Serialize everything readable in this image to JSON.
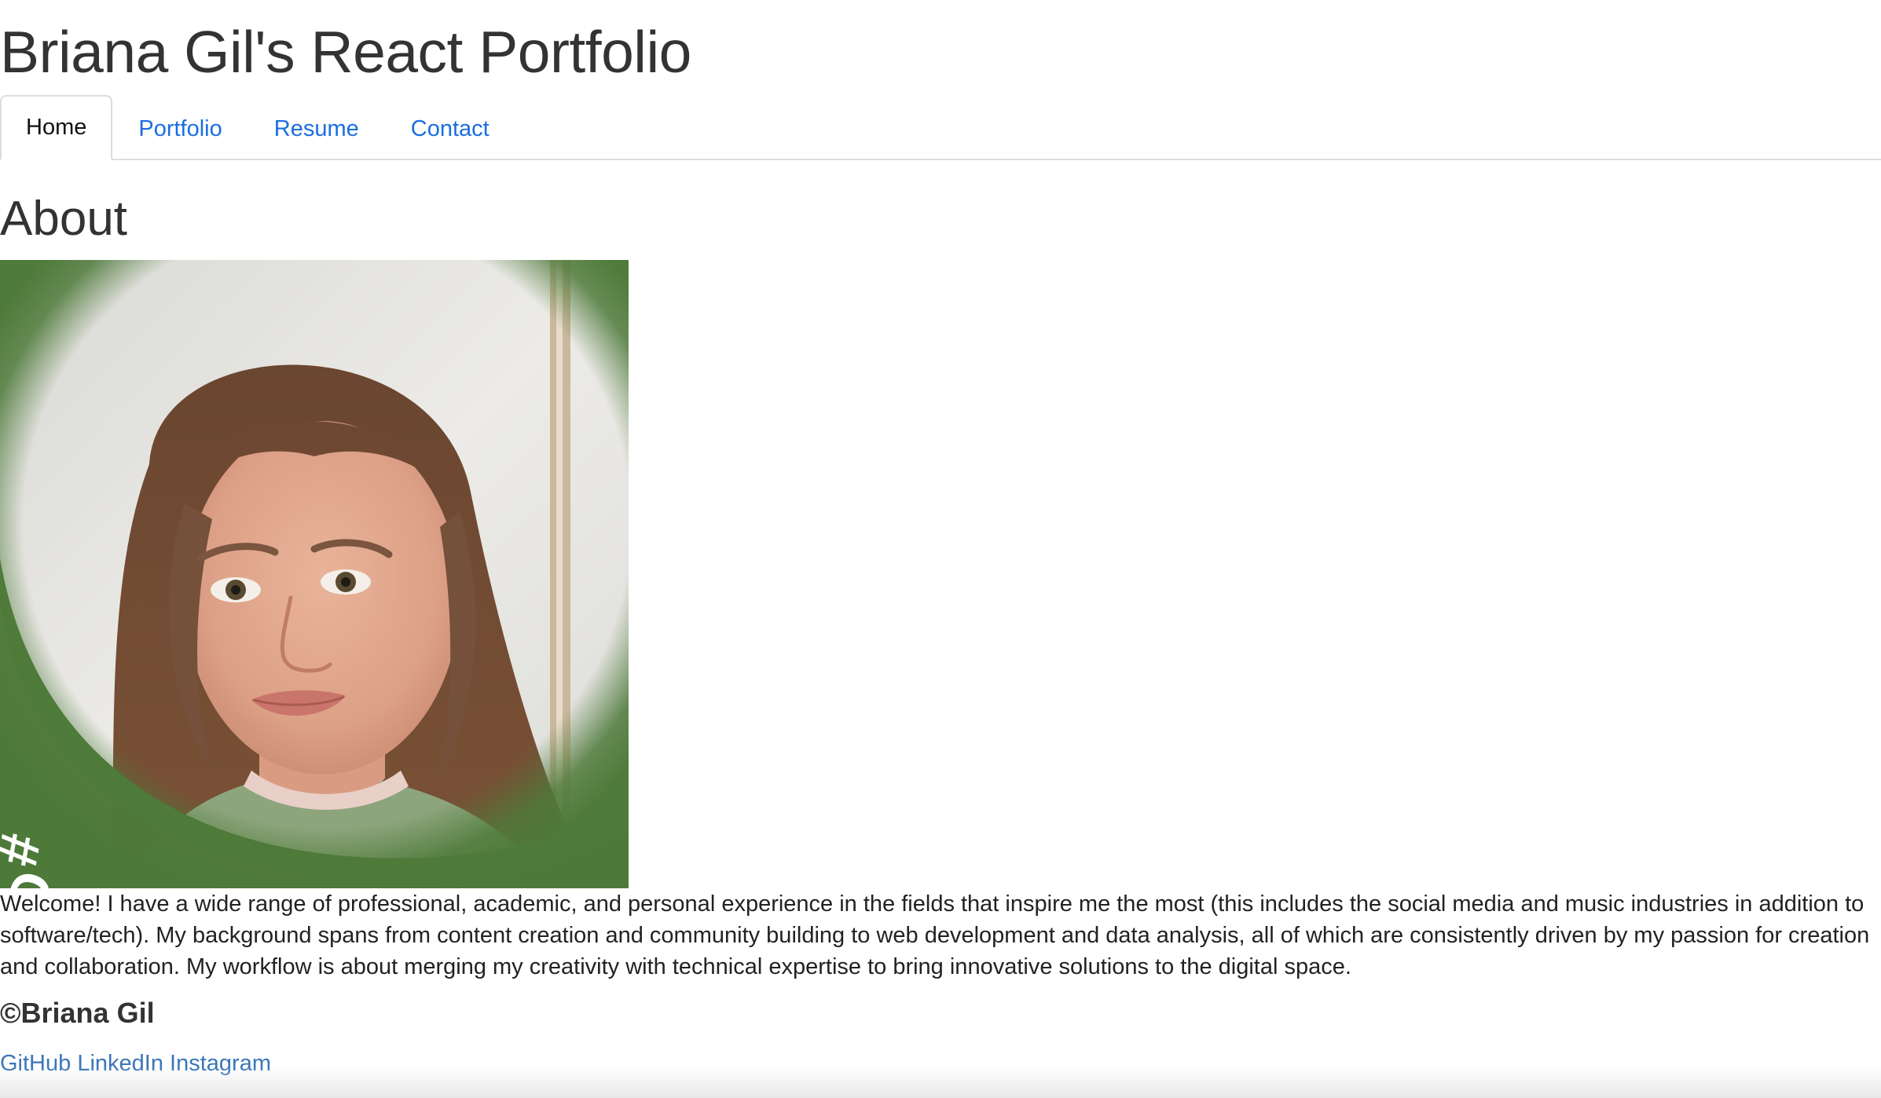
{
  "header": {
    "title": "Briana Gil's React Portfolio"
  },
  "nav": {
    "tabs": [
      {
        "label": "Home",
        "active": true
      },
      {
        "label": "Portfolio",
        "active": false
      },
      {
        "label": "Resume",
        "active": false
      },
      {
        "label": "Contact",
        "active": false
      }
    ]
  },
  "about": {
    "heading": "About",
    "photo": {
      "badge_text": "#OPENTOWORK",
      "badge_color": "#4e7a3a"
    },
    "text": "Welcome! I have a wide range of professional, academic, and personal experience in the fields that inspire me the most (this includes the social media and music industries in addition to software/tech). My background spans from content creation and community building to web development and data analysis, all of which are consistently driven by my passion for creation and collaboration. My workflow is about merging my creativity with technical expertise to bring innovative solutions to the digital space."
  },
  "footer": {
    "copyright": "©Briana Gil",
    "links": [
      {
        "label": "GitHub"
      },
      {
        "label": "LinkedIn"
      },
      {
        "label": "Instagram"
      }
    ]
  },
  "colors": {
    "link": "#1a6ee0",
    "footer_link": "#3a76b8",
    "text": "#333333"
  }
}
